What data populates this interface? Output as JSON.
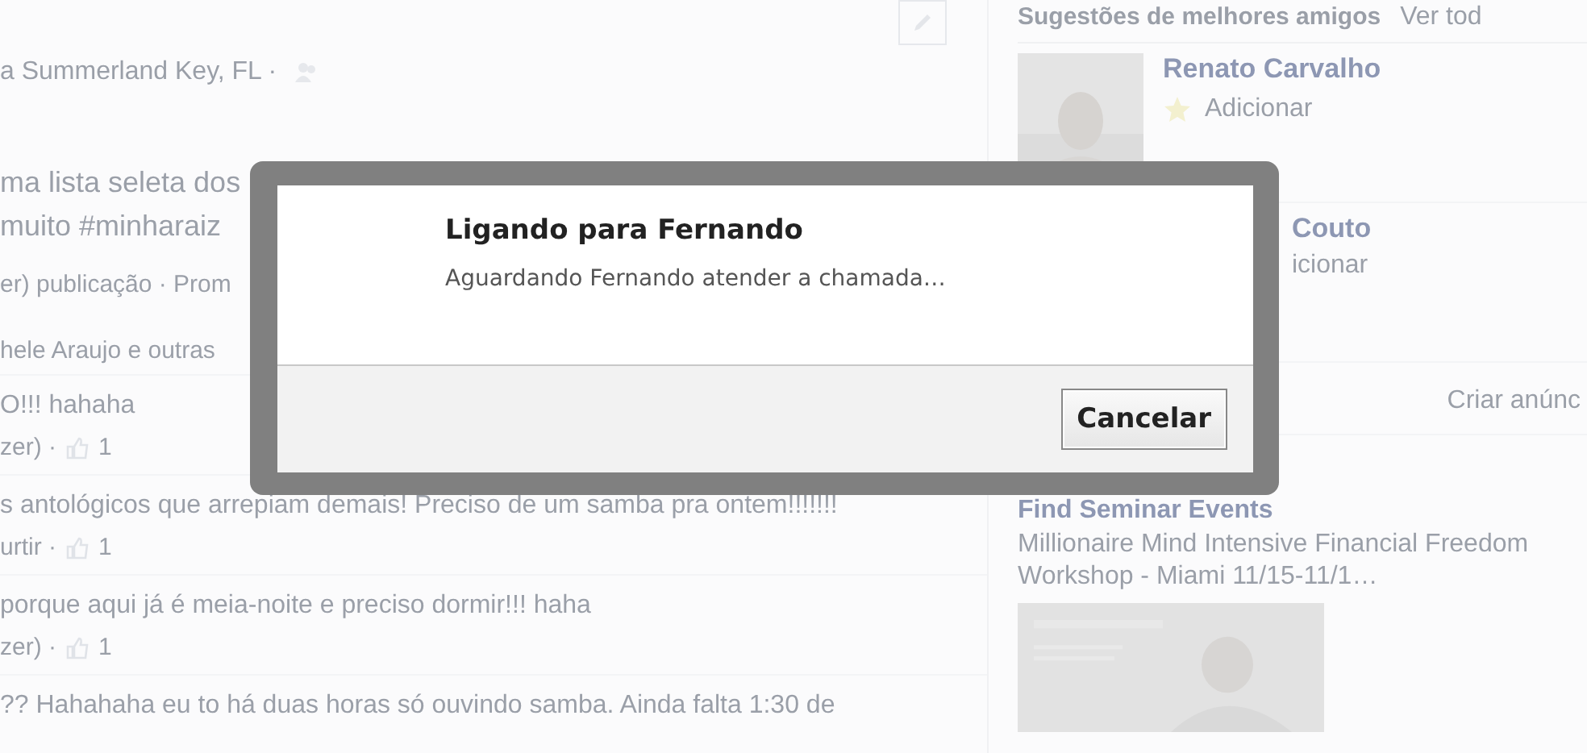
{
  "feed": {
    "location": "a Summerland Key, FL ·",
    "post_lines": [
      "ma lista seleta dos",
      "muito #minharaiz"
    ],
    "post_meta": "er) publicação · Prom",
    "likes_summary": "hele Araujo e outras",
    "comments": [
      {
        "text": "O!!! hahaha",
        "meta": "zer) ·",
        "like_count": "1"
      },
      {
        "text": "s antológicos que arrepiam demais! Preciso de um samba pra ontem!!!!!!!",
        "meta": "urtir ·",
        "like_count": "1"
      },
      {
        "text": " porque aqui já é meia-noite e preciso dormir!!! haha",
        "meta": "zer) ·",
        "like_count": "1"
      }
    ],
    "last_comment": "?? Hahahaha eu to há duas horas só ouvindo samba. Ainda falta 1:30 de"
  },
  "sidebar": {
    "title": "Sugestões de melhores amigos",
    "see_all": "Ver tod",
    "suggestions": [
      {
        "kind": "full",
        "name": "Renato Carvalho",
        "action": "Adicionar"
      },
      {
        "kind": "partial",
        "name": "Couto",
        "action": "icionar"
      }
    ],
    "ad": {
      "create_link": "Criar anúnc",
      "title": "Find Seminar Events",
      "description": "Millionaire Mind Intensive Financial Freedom Workshop - Miami 11/15-11/1…"
    }
  },
  "dialog": {
    "title": "Ligando para Fernando",
    "message": "Aguardando Fernando atender a chamada…",
    "buttons": [
      {
        "label": "Cancelar"
      }
    ]
  }
}
